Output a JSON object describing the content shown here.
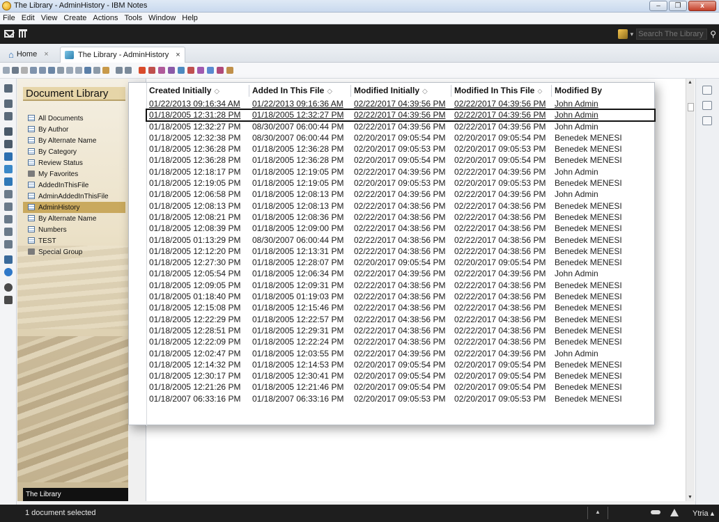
{
  "window": {
    "title": "The Library - AdminHistory - IBM Notes",
    "minimize": "–",
    "maximize": "❐",
    "close": "x"
  },
  "menu": [
    "File",
    "Edit",
    "View",
    "Create",
    "Actions",
    "Tools",
    "Window",
    "Help"
  ],
  "search": {
    "placeholder": "Search The Library - A"
  },
  "tabs": {
    "home": {
      "label": "Home",
      "close": "×"
    },
    "active": {
      "label": "The Library - AdminHistory",
      "close": "×"
    }
  },
  "navigator": {
    "header": "Document Library",
    "items": [
      {
        "label": "All Documents",
        "icon": "view"
      },
      {
        "label": "By Author",
        "icon": "view"
      },
      {
        "label": "By Alternate Name",
        "icon": "view"
      },
      {
        "label": "By Category",
        "icon": "view"
      },
      {
        "label": "Review Status",
        "icon": "view"
      },
      {
        "label": "My Favorites",
        "icon": "folder"
      },
      {
        "label": "AddedInThisFile",
        "icon": "view"
      },
      {
        "label": "AdminAddedInThisFile",
        "icon": "view"
      },
      {
        "label": "AdminHistory",
        "icon": "view",
        "selected": true
      },
      {
        "label": "By Alternate Name",
        "icon": "view"
      },
      {
        "label": "Numbers",
        "icon": "view"
      },
      {
        "label": "TEST",
        "icon": "view"
      },
      {
        "label": "Special Group",
        "icon": "folder"
      }
    ],
    "footer": "The Library"
  },
  "table": {
    "headers": [
      {
        "label": "Created Initially",
        "sort": "◇"
      },
      {
        "label": "Added In This File",
        "sort": "◇"
      },
      {
        "label": "Modified Initially",
        "sort": "◇"
      },
      {
        "label": "Modified In This File",
        "sort": "⬦"
      },
      {
        "label": "Modified By",
        "sort": ""
      }
    ],
    "rows": [
      [
        "01/22/2013 09:16:34 AM",
        "01/22/2013 09:16:36 AM",
        "02/22/2017 04:39:56 PM",
        "02/22/2017 04:39:56 PM",
        "John Admin"
      ],
      [
        "01/18/2005 12:31:28 PM",
        "01/18/2005 12:32:27 PM",
        "02/22/2017 04:39:56 PM",
        "02/22/2017 04:39:56 PM",
        "John Admin"
      ],
      [
        "01/18/2005 12:32:27 PM",
        "08/30/2007 06:00:44 PM",
        "02/22/2017 04:39:56 PM",
        "02/22/2017 04:39:56 PM",
        "John Admin"
      ],
      [
        "01/18/2005 12:32:38 PM",
        "08/30/2007 06:00:44 PM",
        "02/20/2017 09:05:54 PM",
        "02/20/2017 09:05:54 PM",
        "Benedek MENESI"
      ],
      [
        "01/18/2005 12:36:28 PM",
        "01/18/2005 12:36:28 PM",
        "02/20/2017 09:05:53 PM",
        "02/20/2017 09:05:53 PM",
        "Benedek MENESI"
      ],
      [
        "01/18/2005 12:36:28 PM",
        "01/18/2005 12:36:28 PM",
        "02/20/2017 09:05:54 PM",
        "02/20/2017 09:05:54 PM",
        "Benedek MENESI"
      ],
      [
        "01/18/2005 12:18:17 PM",
        "01/18/2005 12:19:05 PM",
        "02/22/2017 04:39:56 PM",
        "02/22/2017 04:39:56 PM",
        "John Admin"
      ],
      [
        "01/18/2005 12:19:05 PM",
        "01/18/2005 12:19:05 PM",
        "02/20/2017 09:05:53 PM",
        "02/20/2017 09:05:53 PM",
        "Benedek MENESI"
      ],
      [
        "01/18/2005 12:06:58 PM",
        "01/18/2005 12:08:13 PM",
        "02/22/2017 04:39:56 PM",
        "02/22/2017 04:39:56 PM",
        "John Admin"
      ],
      [
        "01/18/2005 12:08:13 PM",
        "01/18/2005 12:08:13 PM",
        "02/22/2017 04:38:56 PM",
        "02/22/2017 04:38:56 PM",
        "Benedek MENESI"
      ],
      [
        "01/18/2005 12:08:21 PM",
        "01/18/2005 12:08:36 PM",
        "02/22/2017 04:38:56 PM",
        "02/22/2017 04:38:56 PM",
        "Benedek MENESI"
      ],
      [
        "01/18/2005 12:08:39 PM",
        "01/18/2005 12:09:00 PM",
        "02/22/2017 04:38:56 PM",
        "02/22/2017 04:38:56 PM",
        "Benedek MENESI"
      ],
      [
        "01/18/2005 01:13:29 PM",
        "08/30/2007 06:00:44 PM",
        "02/22/2017 04:38:56 PM",
        "02/22/2017 04:38:56 PM",
        "Benedek MENESI"
      ],
      [
        "01/18/2005 12:12:20 PM",
        "01/18/2005 12:13:31 PM",
        "02/22/2017 04:38:56 PM",
        "02/22/2017 04:38:56 PM",
        "Benedek MENESI"
      ],
      [
        "01/18/2005 12:27:30 PM",
        "01/18/2005 12:28:07 PM",
        "02/20/2017 09:05:54 PM",
        "02/20/2017 09:05:54 PM",
        "Benedek MENESI"
      ],
      [
        "01/18/2005 12:05:54 PM",
        "01/18/2005 12:06:34 PM",
        "02/22/2017 04:39:56 PM",
        "02/22/2017 04:39:56 PM",
        "John Admin"
      ],
      [
        "01/18/2005 12:09:05 PM",
        "01/18/2005 12:09:31 PM",
        "02/22/2017 04:38:56 PM",
        "02/22/2017 04:38:56 PM",
        "Benedek MENESI"
      ],
      [
        "01/18/2005 01:18:40 PM",
        "01/18/2005 01:19:03 PM",
        "02/22/2017 04:38:56 PM",
        "02/22/2017 04:38:56 PM",
        "Benedek MENESI"
      ],
      [
        "01/18/2005 12:15:08 PM",
        "01/18/2005 12:15:46 PM",
        "02/22/2017 04:38:56 PM",
        "02/22/2017 04:38:56 PM",
        "Benedek MENESI"
      ],
      [
        "01/18/2005 12:22:29 PM",
        "01/18/2005 12:22:57 PM",
        "02/22/2017 04:38:56 PM",
        "02/22/2017 04:38:56 PM",
        "Benedek MENESI"
      ],
      [
        "01/18/2005 12:28:51 PM",
        "01/18/2005 12:29:31 PM",
        "02/22/2017 04:38:56 PM",
        "02/22/2017 04:38:56 PM",
        "Benedek MENESI"
      ],
      [
        "01/18/2005 12:22:09 PM",
        "01/18/2005 12:22:24 PM",
        "02/22/2017 04:38:56 PM",
        "02/22/2017 04:38:56 PM",
        "Benedek MENESI"
      ],
      [
        "01/18/2005 12:02:47 PM",
        "01/18/2005 12:03:55 PM",
        "02/22/2017 04:39:56 PM",
        "02/22/2017 04:39:56 PM",
        "John Admin"
      ],
      [
        "01/18/2005 12:14:32 PM",
        "01/18/2005 12:14:53 PM",
        "02/20/2017 09:05:54 PM",
        "02/20/2017 09:05:54 PM",
        "Benedek MENESI"
      ],
      [
        "01/18/2005 12:30:17 PM",
        "01/18/2005 12:30:41 PM",
        "02/20/2017 09:05:54 PM",
        "02/20/2017 09:05:54 PM",
        "Benedek MENESI"
      ],
      [
        "01/18/2005 12:21:26 PM",
        "01/18/2005 12:21:46 PM",
        "02/20/2017 09:05:54 PM",
        "02/20/2017 09:05:54 PM",
        "Benedek MENESI"
      ],
      [
        "01/18/2007 06:33:16 PM",
        "01/18/2007 06:33:16 PM",
        "02/20/2017 09:05:53 PM",
        "02/20/2017 09:05:53 PM",
        "Benedek MENESI"
      ]
    ],
    "selected_row": 1
  },
  "status": {
    "message": "1 document selected",
    "up_arrow": "▲",
    "location": "Ytria ▴"
  },
  "scroll": {
    "up": "▲",
    "down": "▼"
  },
  "icons": {
    "toolbar": [
      "new-doc-icon",
      "print-icon",
      "cancel-icon",
      "forward-icon",
      "reply-icon",
      "move-icon",
      "flag-icon",
      "copy-icon",
      "preview-icon",
      "refresh-icon",
      "properties-icon",
      "tool-icon",
      "list-icon",
      "table-icon",
      "plugin-icon-1",
      "plugin-icon-2",
      "plugin-icon-3",
      "plugin-icon-4",
      "plugin-icon-5",
      "plugin-icon-6",
      "plugin-icon-7",
      "plugin-icon-8",
      "plugin-icon-9",
      "plugin-icon-10"
    ],
    "rail": [
      "binoculars-icon",
      "mail-icon",
      "calendar-icon",
      "contacts-icon",
      "todo-icon",
      "sync-icon",
      "db-icon-1",
      "db-icon-2",
      "db-icon-3",
      "db-icon-4",
      "db-icon-5",
      "db-icon-6",
      "db-icon-7",
      "tools-icon",
      "globe-icon",
      "info-icon",
      "home-icon"
    ]
  },
  "colors": {
    "nav_selected": "#c9a95e",
    "nav_header": "#e6d5a8",
    "darkbar": "#1e1e1e"
  }
}
